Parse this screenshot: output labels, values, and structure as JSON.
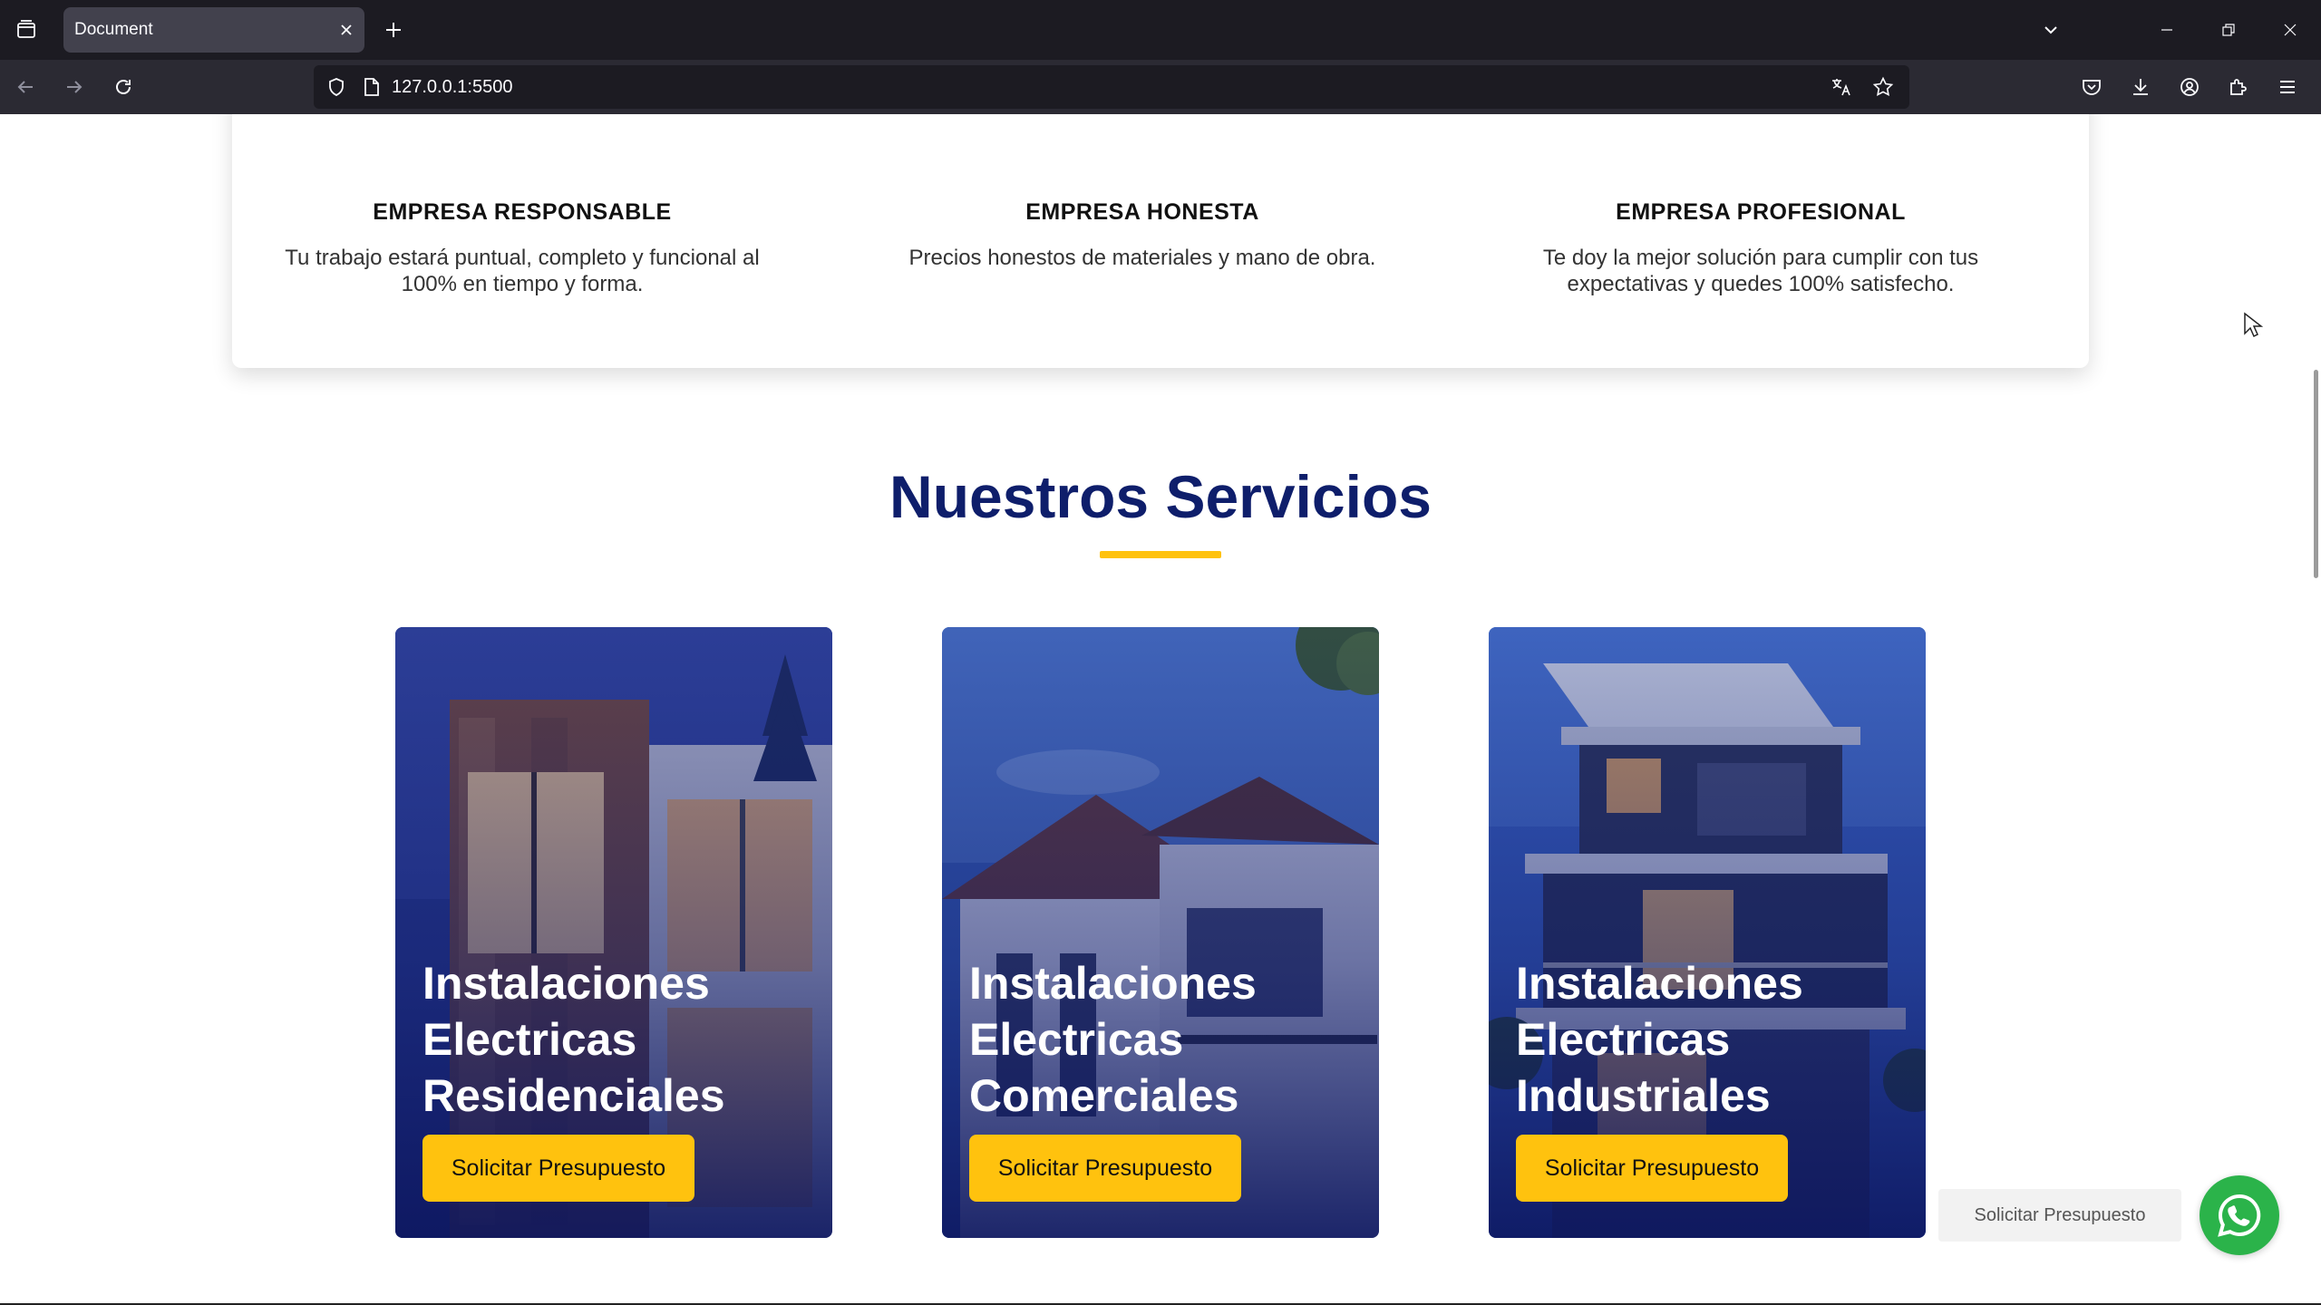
{
  "browser": {
    "tab_title": "Document",
    "url": "127.0.0.1:5500"
  },
  "features": [
    {
      "title": "EMPRESA RESPONSABLE",
      "desc": "Tu trabajo estará puntual, completo y funcional al 100% en tiempo y forma."
    },
    {
      "title": "EMPRESA HONESTA",
      "desc": "Precios honestos de materiales y mano de obra."
    },
    {
      "title": "EMPRESA PROFESIONAL",
      "desc": "Te doy la mejor solución para cumplir con tus expectativas y quedes 100% satisfecho."
    }
  ],
  "services": {
    "title": "Nuestros Servicios",
    "cards": [
      {
        "title": "Instalaciones Electricas Residenciales",
        "button": "Solicitar Presupuesto"
      },
      {
        "title": "Instalaciones Electricas Comerciales",
        "button": "Solicitar Presupuesto"
      },
      {
        "title": "Instalaciones Electricas Industriales",
        "button": "Solicitar Presupuesto"
      }
    ]
  },
  "floating": {
    "label": "Solicitar Presupuesto",
    "icon": "whatsapp-icon"
  },
  "colors": {
    "accent_yellow": "#ffc20e",
    "title_navy": "#0e1e6b",
    "whatsapp_green": "#2bb34a"
  }
}
